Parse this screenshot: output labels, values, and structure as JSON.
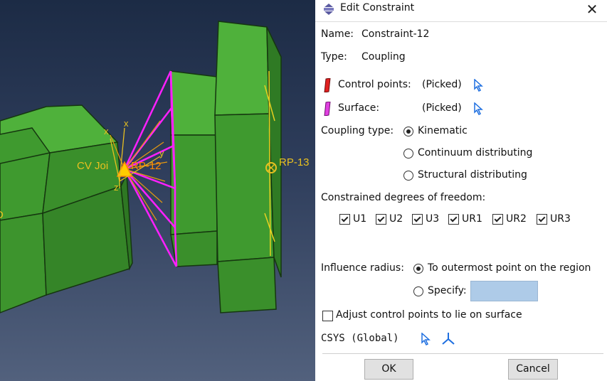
{
  "viewport": {
    "labels": {
      "cv_joint": "CV Joi",
      "rp12": "RP-12",
      "rp13": "RP-13",
      "axis_x1": "x",
      "axis_x2": "x",
      "axis_y": "y",
      "axis_z": "z",
      "side_label": "D"
    },
    "colors": {
      "part": "#3f9a2f",
      "part_edge": "#15360f",
      "surface": "#ff20ff",
      "points": "#e8c020"
    }
  },
  "dialog": {
    "title": "Edit Constraint",
    "close_glyph": "✕",
    "name_label": "Name:",
    "name_value": "Constraint-12",
    "type_label": "Type:",
    "type_value": "Coupling",
    "control_points_label": "Control points:",
    "control_points_value": "(Picked)",
    "surface_label": "Surface:",
    "surface_value": "(Picked)",
    "coupling_type_label": "Coupling type:",
    "coupling_options": [
      {
        "label": "Kinematic",
        "selected": true
      },
      {
        "label": "Continuum distributing",
        "selected": false
      },
      {
        "label": "Structural distributing",
        "selected": false
      }
    ],
    "dof_label": "Constrained degrees of freedom:",
    "dof": [
      {
        "label": "U1",
        "checked": true
      },
      {
        "label": "U2",
        "checked": true
      },
      {
        "label": "U3",
        "checked": true
      },
      {
        "label": "UR1",
        "checked": true
      },
      {
        "label": "UR2",
        "checked": true
      },
      {
        "label": "UR3",
        "checked": true
      }
    ],
    "influence_label": "Influence radius:",
    "influence_options": [
      {
        "label": "To outermost point on the region",
        "selected": true
      },
      {
        "label": "Specify:",
        "selected": false
      }
    ],
    "specify_value": "",
    "adjust_label": "Adjust control points to lie on surface",
    "adjust_checked": false,
    "csys_label": "CSYS (Global)",
    "ok_label": "OK",
    "cancel_label": "Cancel",
    "colors": {
      "control_icon": "#e02020",
      "surface_icon": "#e040e0",
      "cursor_icon": "#1e6fe0",
      "field_bg": "#aecbe8"
    }
  }
}
